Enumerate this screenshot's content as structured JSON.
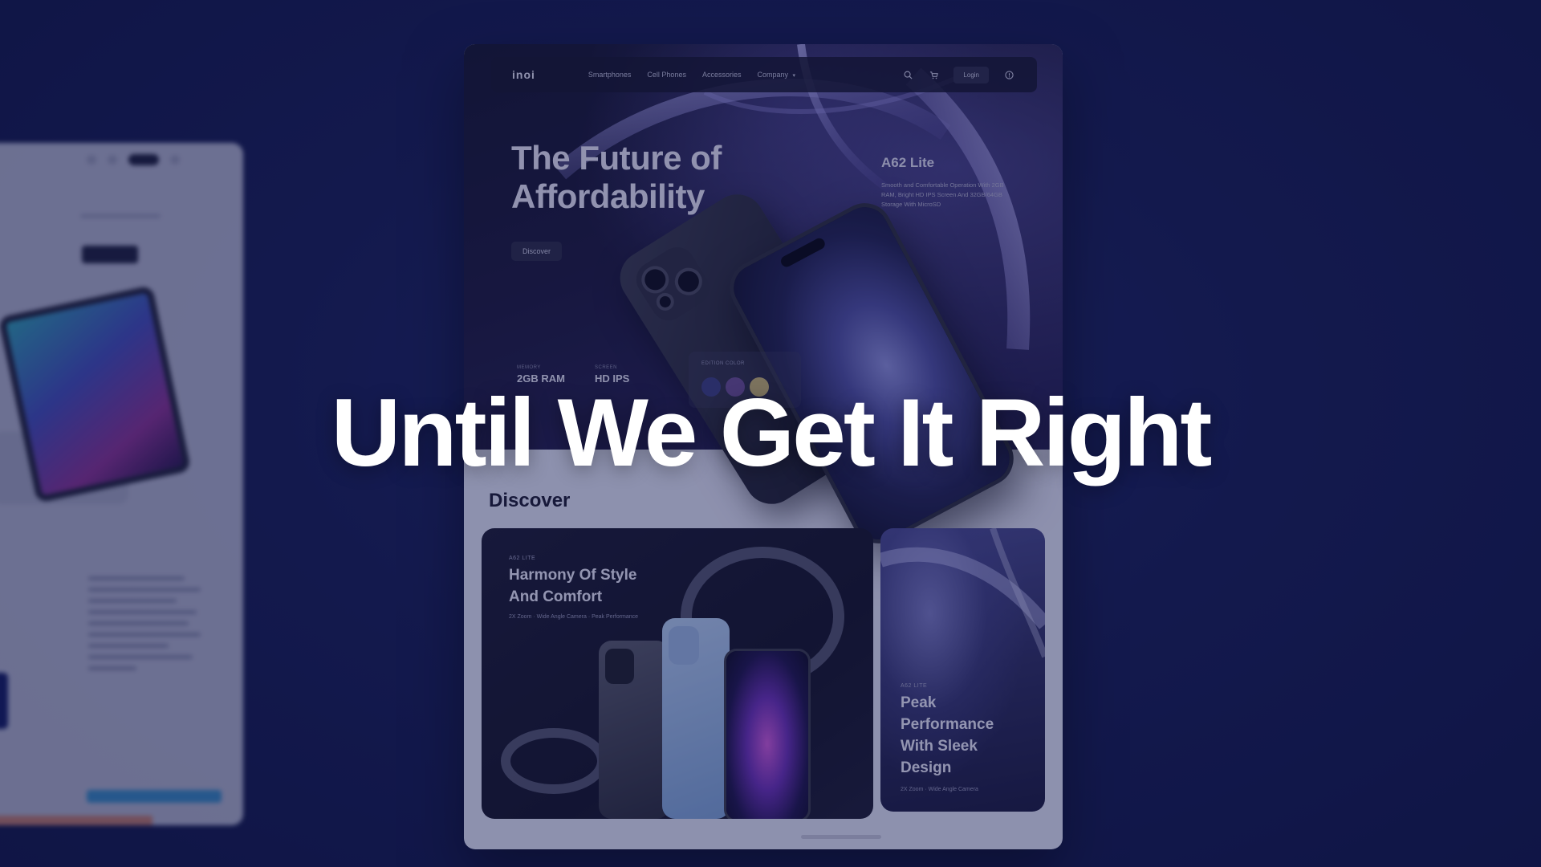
{
  "nav": {
    "logo": "inoi",
    "links": [
      "Smartphones",
      "Cell Phones",
      "Accessories",
      "Company"
    ],
    "login": "Login"
  },
  "hero": {
    "title": "The Future of Affordability",
    "discover_btn": "Discover",
    "product_name": "A62 Lite",
    "product_desc": "Smooth and Comfortable Operation With 2GB RAM, Bright HD IPS Screen And 32GB/64GB Storage With MicroSD",
    "specs": [
      {
        "key": "MEMORY",
        "value": "2GB RAM"
      },
      {
        "key": "SCREEN",
        "value": "HD IPS"
      }
    ],
    "color_label": "EDITION COLOR",
    "swatches": [
      "#3c3e7a",
      "#6b4f8e",
      "#c9b66a"
    ]
  },
  "discover": {
    "title": "Discover",
    "card1": {
      "tag": "A62 LITE",
      "title": "Harmony Of Style And Comfort",
      "features": "2X Zoom  ·  Wide Angle Camera  ·  Peak Performance"
    },
    "card2": {
      "tag": "A62 LITE",
      "title": "Peak Performance With Sleek Design",
      "features": "2X Zoom  ·  Wide Angle Camera"
    }
  },
  "headline": "Until We Get It Right",
  "colors": {
    "background": "#141b4d",
    "accent": "#ffffff"
  }
}
